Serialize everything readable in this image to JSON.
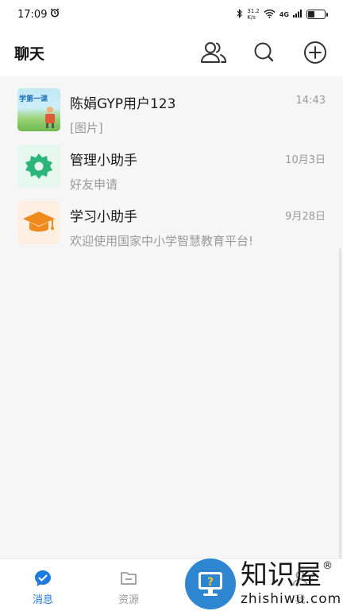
{
  "status_bar": {
    "time": "17:09",
    "net_speed_top": "31.2",
    "net_speed_bottom": "K/s",
    "network": "4G"
  },
  "header": {
    "title": "聊天"
  },
  "chats": [
    {
      "name": "陈娟GYP用户123",
      "preview": "[图片]",
      "time": "14:43",
      "avatar_text": "学第一课"
    },
    {
      "name": "管理小助手",
      "preview": "好友申请",
      "time": "10月3日"
    },
    {
      "name": "学习小助手",
      "preview": "欢迎使用国家中小学智慧教育平台!",
      "time": "9月28日"
    }
  ],
  "bottom_nav": [
    {
      "label": "消息",
      "icon": "chat-bubble-icon",
      "active": true
    },
    {
      "label": "资源",
      "icon": "folder-icon",
      "active": false
    },
    {
      "label": "我",
      "icon": "person-icon",
      "active": false
    }
  ],
  "watermark": {
    "cn": "知识屋",
    "en": "zhishiwu.com",
    "registered": "®"
  },
  "colors": {
    "accent": "#1f7ae0",
    "manager_green": "#2bb57a",
    "study_orange": "#f08a1c",
    "watermark_blue": "#2e86d1"
  }
}
